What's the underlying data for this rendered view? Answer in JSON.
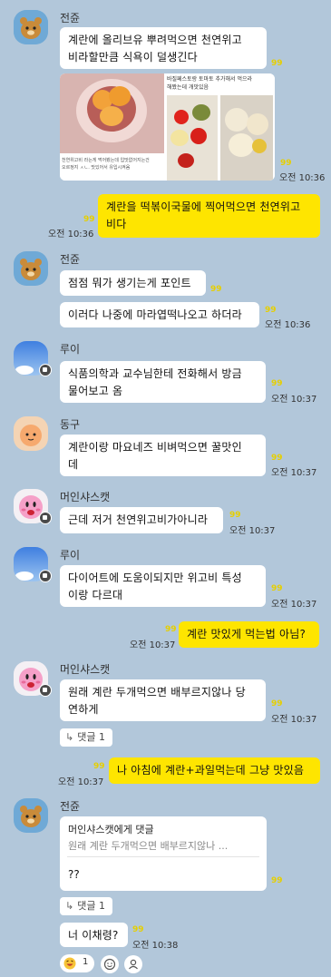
{
  "messages": {
    "m1": {
      "sender": "전쥰",
      "text": "계란에 올리브유 뿌려먹으면 천연위고\n비라할만큼 식욕이 덜생긴다",
      "unread": "99"
    },
    "img": {
      "caption_tl1": "천연위고비 라는게 먹어봤는데 입맛없어지는건",
      "caption_tl2": "오르정지 ㅅㄴ. 맛있어서 유입시켜옴",
      "caption_top": "바질페스토랑 토마토 추가해서 먹으라",
      "caption_top2": "해봤는데 개맛있음",
      "unread": "99",
      "time": "오전 10:36"
    },
    "m2": {
      "text": "계란을 떡볶이국물에 찍어먹으면 천연위고\n비다",
      "unread": "99",
      "time": "오전 10:36"
    },
    "m3": {
      "sender": "전쥰",
      "text": "점점 뭐가 생기는게 포인트",
      "unread": "99"
    },
    "m4": {
      "text": "이러다 나중에 마라엽떡나오고 하더라",
      "unread": "99",
      "time": "오전 10:36"
    },
    "m5": {
      "sender": "루이",
      "text": "식품의학과 교수님한테 전화해서 방금\n물어보고 옴",
      "unread": "99",
      "time": "오전 10:37"
    },
    "m6": {
      "sender": "동구",
      "text": "계란이랑 마요네즈 비벼먹으면 꿀맛인\n데",
      "unread": "99",
      "time": "오전 10:37"
    },
    "m7": {
      "sender": "머인샤스캣",
      "text": "근데 저거 천연위고비가아니라",
      "unread": "99",
      "time": "오전 10:37"
    },
    "m8": {
      "sender": "루이",
      "text": "다이어트에 도움이되지만 위고비 특성\n이랑 다르대",
      "unread": "99",
      "time": "오전 10:37"
    },
    "m9": {
      "text": "계란 맛있게 먹는법 아님?",
      "unread": "99",
      "time": "오전 10:37"
    },
    "m10": {
      "sender": "머인샤스캣",
      "text": "원래 계란 두개먹으면 배부르지않나 당\n연하게",
      "unread": "99",
      "time": "오전 10:37",
      "reply": "댓글 1"
    },
    "m11": {
      "text": "나 아침에 계란+과일먹는데 그냥 맛있음",
      "unread": "99",
      "time": "오전 10:37"
    },
    "m12": {
      "sender": "전쥰",
      "quote_title": "머인샤스캣에게 댓글",
      "quote_text": "원래 계란 두개먹으면 배부르지않나 ...",
      "text": "??",
      "unread": "99",
      "reply": "댓글 1"
    },
    "m13": {
      "text": "너 이채령?",
      "unread": "99",
      "time": "오전 10:38"
    }
  },
  "reactions": {
    "emoji_count": "1"
  },
  "colors": {
    "background": "#b2c7da",
    "my_bubble": "#fee500",
    "other_bubble": "#ffffff",
    "unread": "#e6cf00"
  },
  "icons": [
    "ryan-avatar",
    "blue-avatar",
    "apeach-avatar",
    "kirby-avatar",
    "reply-arrow-icon",
    "add-reaction-icon",
    "person-icon"
  ]
}
